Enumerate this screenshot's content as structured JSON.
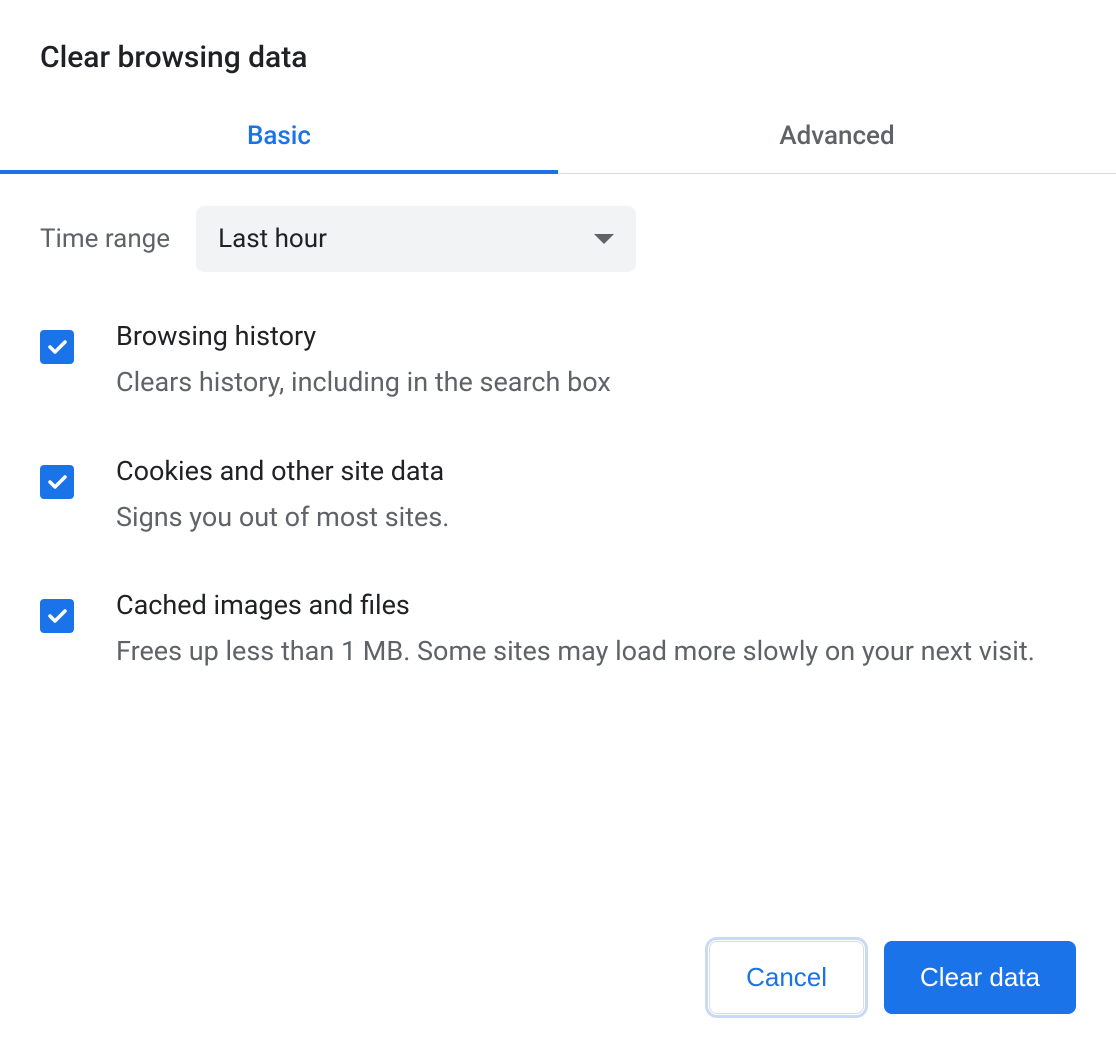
{
  "dialog": {
    "title": "Clear browsing data",
    "tabs": {
      "basic_label": "Basic",
      "advanced_label": "Advanced",
      "active": "basic"
    },
    "time_range": {
      "label": "Time range",
      "selected": "Last hour"
    },
    "options": [
      {
        "title": "Browsing history",
        "description": "Clears history, including in the search box",
        "checked": true
      },
      {
        "title": "Cookies and other site data",
        "description": "Signs you out of most sites.",
        "checked": true
      },
      {
        "title": "Cached images and files",
        "description": "Frees up less than 1 MB. Some sites may load more slowly on your next visit.",
        "checked": true
      }
    ],
    "footer": {
      "cancel_label": "Cancel",
      "confirm_label": "Clear data"
    }
  },
  "colors": {
    "accent": "#1a73e8",
    "text_primary": "#202124",
    "text_secondary": "#5f6368",
    "surface_variant": "#f1f3f4",
    "divider": "#dadce0"
  }
}
